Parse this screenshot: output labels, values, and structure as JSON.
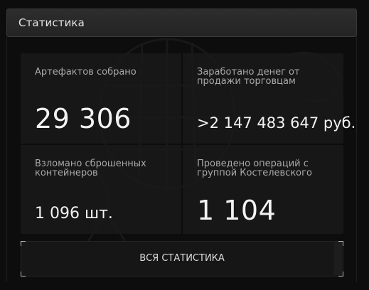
{
  "header": {
    "title": "Статистика"
  },
  "cards": [
    {
      "label": "Артефактов собрано",
      "value": "29 306"
    },
    {
      "label": "Заработано денег от продажи торговцам",
      "value": ">2 147 483 647 руб."
    },
    {
      "label": "Взломано сброшенных контейнеров",
      "value": "1 096 шт."
    },
    {
      "label": "Проведено операций с группой Костелевского",
      "value": "1 104"
    }
  ],
  "footer": {
    "all_stats_label": "ВСЯ СТАТИСТИКА"
  },
  "colors": {
    "background": "#0d0d0d",
    "card": "#1a1a1a",
    "header": "#2a2a2a",
    "text": "#f2f2f2",
    "label": "#a9a9a9"
  },
  "icons": {
    "background_art": "grenade-and-sack-silhouette"
  }
}
